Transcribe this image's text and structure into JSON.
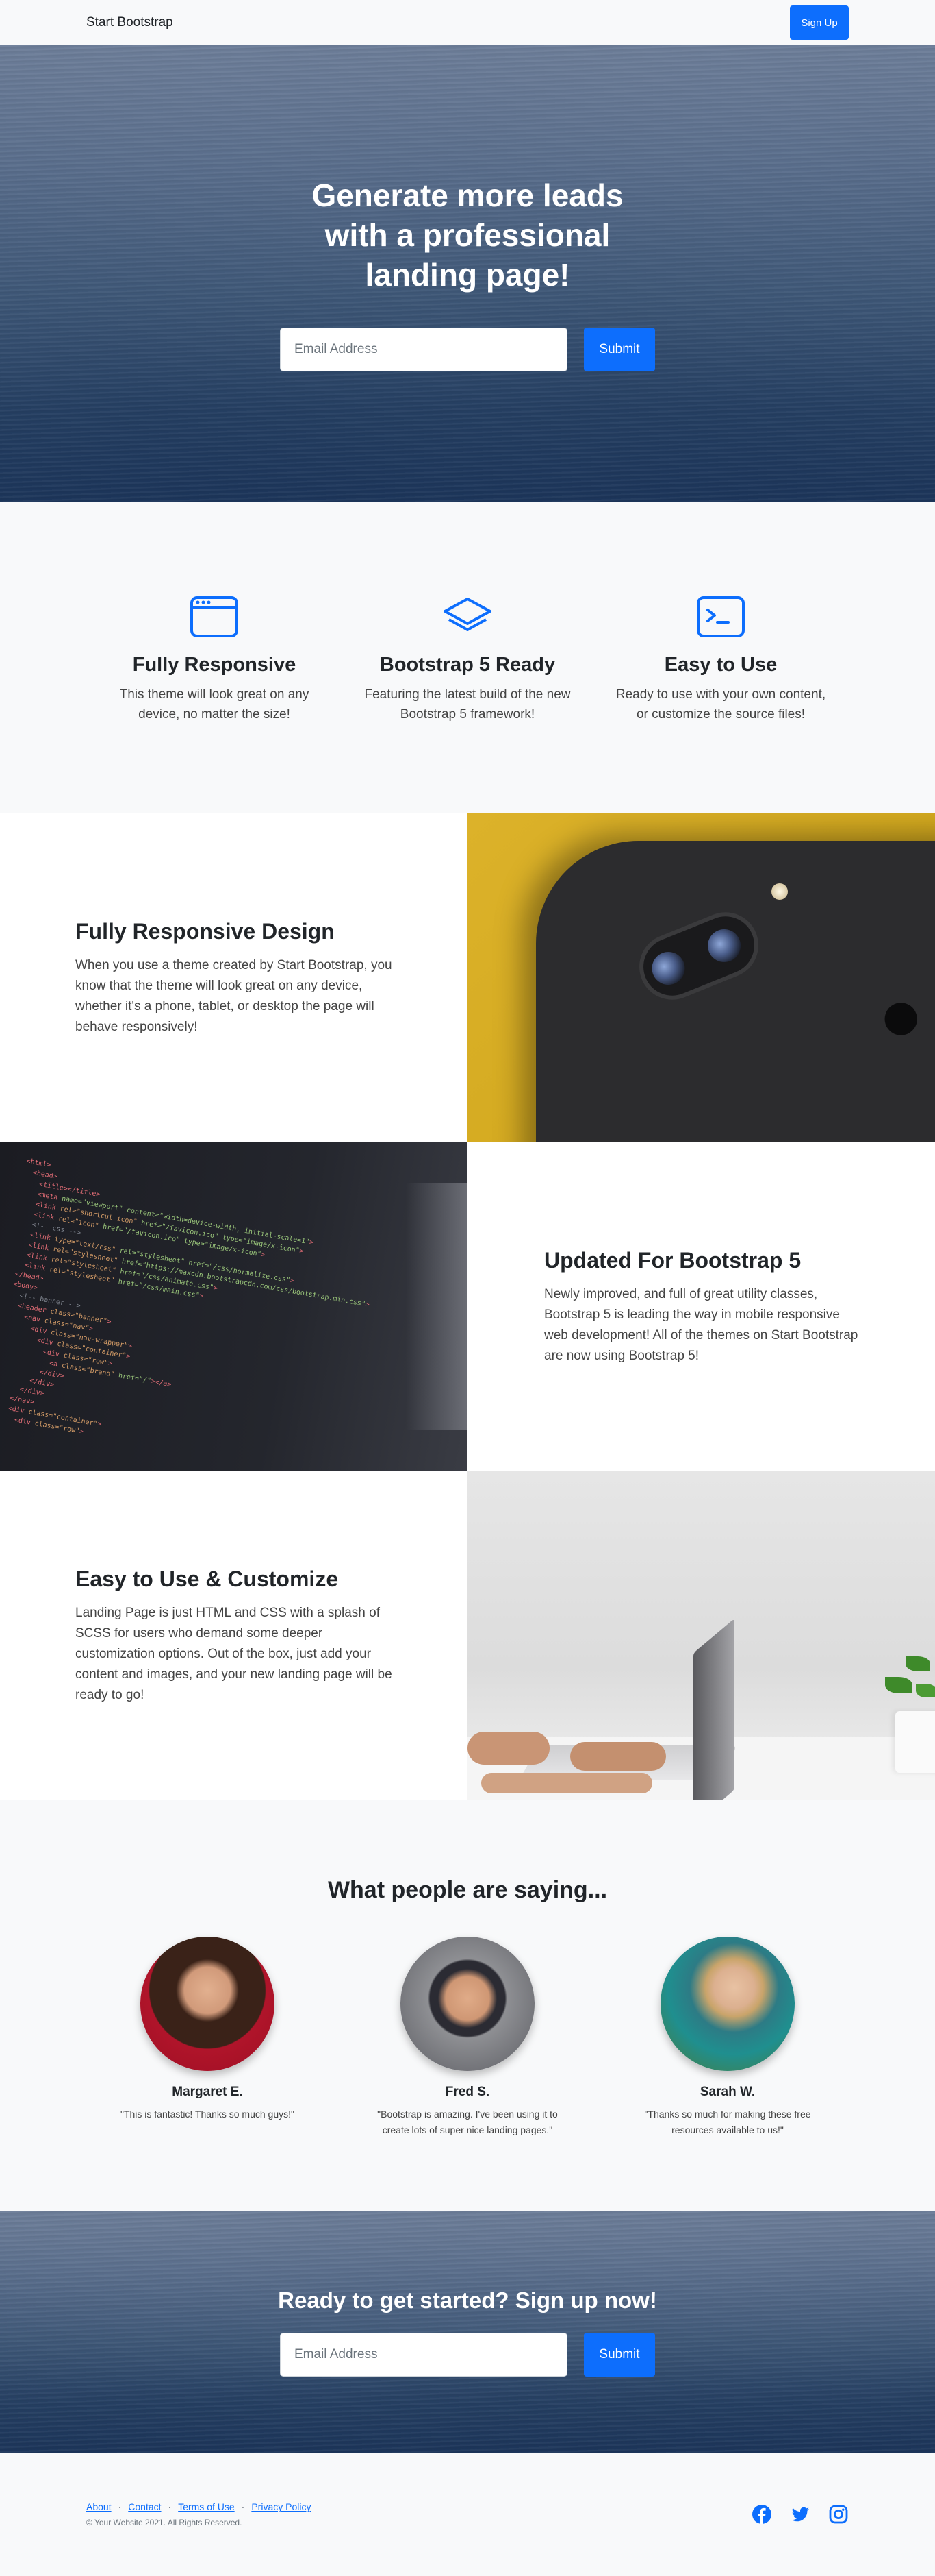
{
  "nav": {
    "brand": "Start Bootstrap",
    "signup_label": "Sign Up"
  },
  "hero": {
    "title": "Generate more leads with a professional landing page!",
    "email_placeholder": "Email Address",
    "submit_label": "Submit"
  },
  "features": [
    {
      "icon": "browser-window-icon",
      "title": "Fully Responsive",
      "text": "This theme will look great on any device, no matter the size!"
    },
    {
      "icon": "layers-icon",
      "title": "Bootstrap 5 Ready",
      "text": "Featuring the latest build of the new Bootstrap 5 framework!"
    },
    {
      "icon": "terminal-icon",
      "title": "Easy to Use",
      "text": "Ready to use with your own content, or customize the source files!"
    }
  ],
  "showcase": [
    {
      "title": "Fully Responsive Design",
      "text": "When you use a theme created by Start Bootstrap, you know that the theme will look great on any device, whether it's a phone, tablet, or desktop the page will behave responsively!"
    },
    {
      "title": "Updated For Bootstrap 5",
      "text": "Newly improved, and full of great utility classes, Bootstrap 5 is leading the way in mobile responsive web development! All of the themes on Start Bootstrap are now using Bootstrap 5!"
    },
    {
      "title": "Easy to Use & Customize",
      "text": "Landing Page is just HTML and CSS with a splash of SCSS for users who demand some deeper customization options. Out of the box, just add your content and images, and your new landing page will be ready to go!"
    }
  ],
  "testimonials": {
    "heading": "What people are saying...",
    "items": [
      {
        "name": "Margaret E.",
        "quote": "\"This is fantastic! Thanks so much guys!\""
      },
      {
        "name": "Fred S.",
        "quote": "\"Bootstrap is amazing. I've been using it to create lots of super nice landing pages.\""
      },
      {
        "name": "Sarah W.",
        "quote": "\"Thanks so much for making these free resources available to us!\""
      }
    ]
  },
  "cta": {
    "heading": "Ready to get started? Sign up now!",
    "email_placeholder": "Email Address",
    "submit_label": "Submit"
  },
  "footer": {
    "links": [
      "About",
      "Contact",
      "Terms of Use",
      "Privacy Policy"
    ],
    "separator": "·",
    "copyright": "© Your Website 2021. All Rights Reserved.",
    "socials": [
      "facebook-icon",
      "twitter-icon",
      "instagram-icon"
    ]
  },
  "colors": {
    "primary": "#0d6efd",
    "light": "#f8f9fa",
    "dark": "#212529"
  }
}
